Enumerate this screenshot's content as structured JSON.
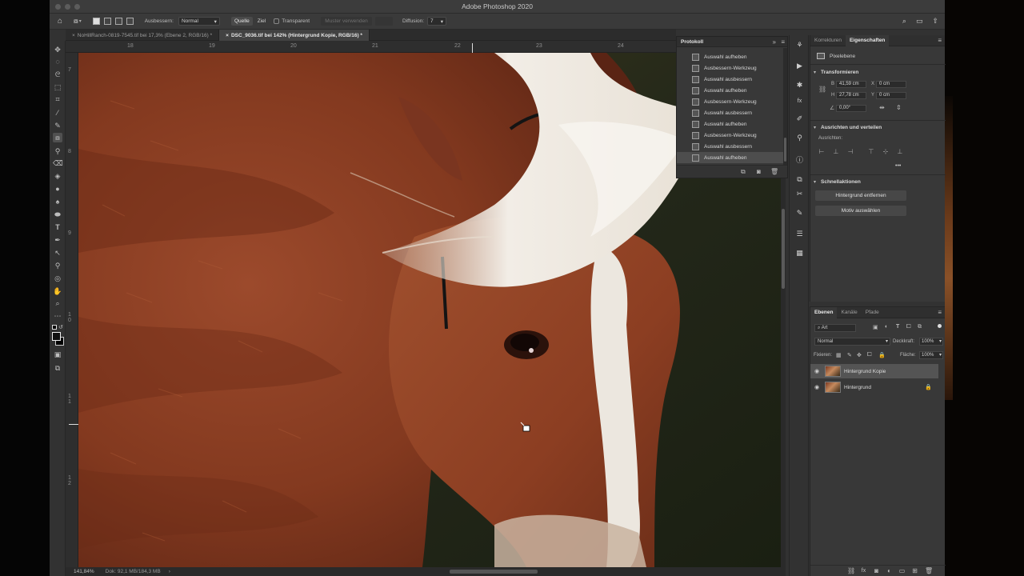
{
  "app": {
    "title": "Adobe Photoshop 2020"
  },
  "options_bar": {
    "mode_label": "Ausbessern:",
    "mode_value": "Normal",
    "source_label": "Quelle",
    "dest_label": "Ziel",
    "transparent_label": "Transparent",
    "pattern_label": "Muster verwenden",
    "diffusion_label": "Diffusion:",
    "diffusion_value": "7"
  },
  "document_tabs": [
    {
      "label": "NoHillRanch-0819-7545.tif bei 17,3% (Ebene 2, RGB/16) *",
      "active": false
    },
    {
      "label": "DSC_9036.tif bei 142% (Hintergrund Kopie, RGB/16) *",
      "active": true
    }
  ],
  "ruler": {
    "top": [
      "18",
      "19",
      "20",
      "21",
      "22",
      "23",
      "24"
    ],
    "left": [
      "7",
      "8",
      "9",
      "1\n0",
      "1\n1",
      "1\n2"
    ]
  },
  "status_bar": {
    "zoom": "141,84%",
    "doc": "Dok: 92,1 MB/184,3 MB"
  },
  "history_panel": {
    "tab": "Protokoll",
    "items": [
      "Auswahl aufheben",
      "Ausbessern-Werkzeug",
      "Auswahl ausbessern",
      "Auswahl aufheben",
      "Ausbessern-Werkzeug",
      "Auswahl ausbessern",
      "Auswahl aufheben",
      "Ausbessern-Werkzeug",
      "Auswahl ausbessern",
      "Auswahl aufheben"
    ],
    "selected_index": 9
  },
  "properties_panel": {
    "tab_corrections": "Korrekturen",
    "tab_properties": "Eigenschaften",
    "layer_type": "Pixelebene",
    "transform_head": "Transformieren",
    "w_label": "B",
    "w_value": "41,59 cm",
    "x_label": "X",
    "x_value": "0 cm",
    "h_label": "H",
    "h_value": "27,78 cm",
    "y_label": "Y",
    "y_value": "0 cm",
    "angle_value": "0,00°",
    "align_head": "Ausrichten und verteilen",
    "align_label": "Ausrichten:",
    "more": "•••",
    "quick_head": "Schnellaktionen",
    "remove_bg": "Hintergrund entfernen",
    "select_subject": "Motiv auswählen"
  },
  "layers_panel": {
    "tab_layers": "Ebenen",
    "tab_channels": "Kanäle",
    "tab_paths": "Pfade",
    "filter_value": "Art",
    "blend_mode": "Normal",
    "opacity_label": "Deckkraft:",
    "opacity_value": "100%",
    "lock_label": "Fixieren:",
    "fill_label": "Fläche:",
    "fill_value": "100%",
    "layers": [
      {
        "name": "Hintergrund Kopie",
        "selected": true,
        "locked": false
      },
      {
        "name": "Hintergrund",
        "selected": false,
        "locked": true
      }
    ]
  },
  "colors": {
    "panel_bg": "#383838",
    "selected_row": "#545454",
    "coat": "#8a3a22",
    "mane": "#ece7df"
  }
}
